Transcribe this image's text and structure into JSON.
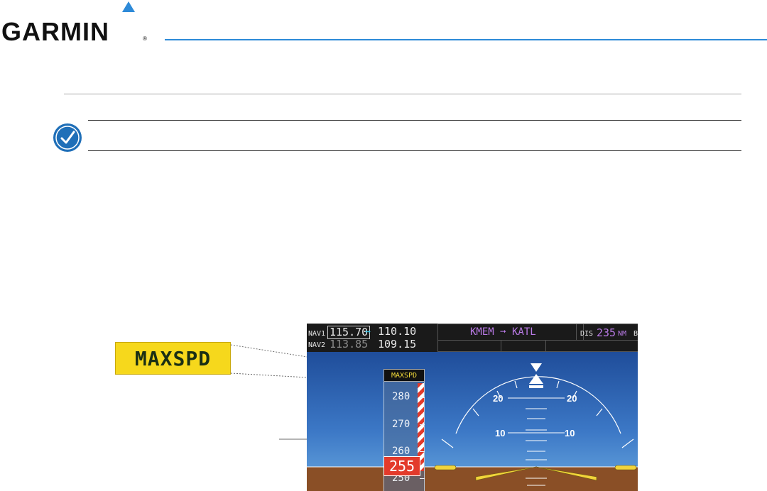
{
  "header": {
    "logo_text": "GARMIN",
    "logo_reg": "®",
    "accent_color": "#2d8ad8"
  },
  "note": {
    "icon": "note-check-icon",
    "text": ""
  },
  "callout": {
    "label": "MAXSPD"
  },
  "pfd": {
    "nav1_label": "NAV1",
    "nav1_active": "115.70",
    "nav1_swap_icon": "↔",
    "nav1_standby": "110.10",
    "nav2_label": "NAV2",
    "nav2_active": "113.85",
    "nav2_standby": "109.15",
    "route": "KMEM ➞ KATL",
    "dis_label": "DIS",
    "dis_value": "235",
    "dis_unit": "NM",
    "b_label": "B",
    "maxspd_label": "MAXSPD",
    "airspeed_ticks": [
      "280",
      "270",
      "260",
      "250"
    ],
    "current_speed": "255",
    "pitch_labels": {
      "p20_left": "20",
      "p20_right": "20",
      "p10_left": "10",
      "p10_right": "10"
    }
  }
}
